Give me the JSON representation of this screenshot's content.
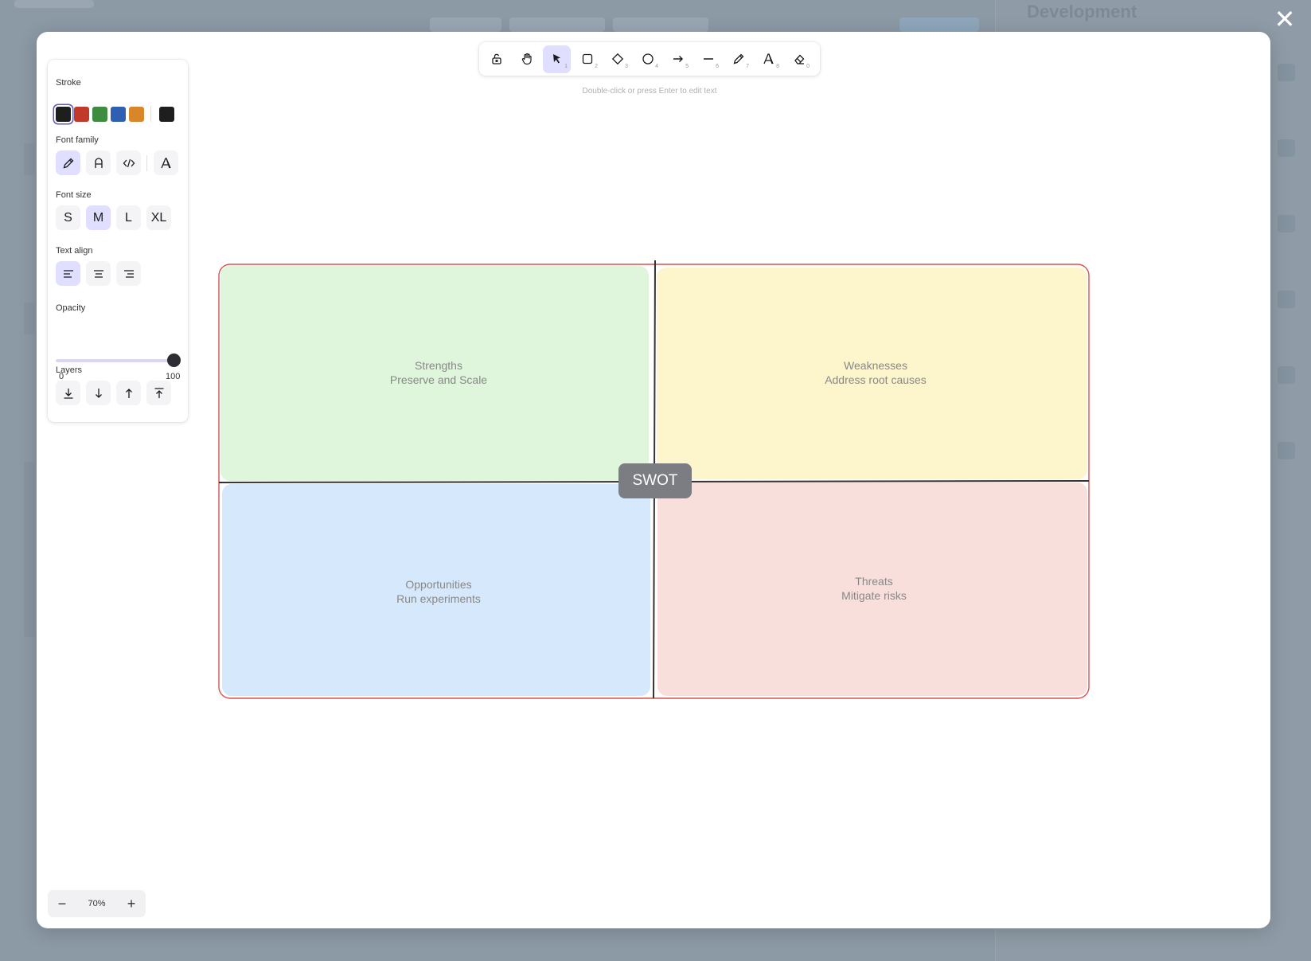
{
  "background": {
    "title": "Development"
  },
  "toolbar": {
    "tools": [
      {
        "name": "lock",
        "key": ""
      },
      {
        "name": "hand",
        "key": ""
      },
      {
        "name": "selection",
        "key": "1"
      },
      {
        "name": "rectangle",
        "key": "2"
      },
      {
        "name": "diamond",
        "key": "3"
      },
      {
        "name": "ellipse",
        "key": "4"
      },
      {
        "name": "arrow",
        "key": "5"
      },
      {
        "name": "line",
        "key": "6"
      },
      {
        "name": "draw",
        "key": "7"
      },
      {
        "name": "text",
        "key": "8"
      },
      {
        "name": "eraser",
        "key": "0"
      }
    ],
    "hint": "Double-click or press Enter to edit text"
  },
  "properties": {
    "stroke_label": "Stroke",
    "stroke_colors": [
      "#1e1e1e",
      "#c0392b",
      "#3d8c40",
      "#2f5fb3",
      "#d9862a"
    ],
    "current_stroke": "#1e1e1e",
    "font_family_label": "Font family",
    "font_size_label": "Font size",
    "font_sizes": [
      "S",
      "M",
      "L",
      "XL"
    ],
    "text_align_label": "Text align",
    "opacity_label": "Opacity",
    "opacity_min": "0",
    "opacity_max": "100",
    "opacity_value": 100,
    "layers_label": "Layers"
  },
  "canvas": {
    "center_label": "SWOT",
    "quadrants": {
      "strengths": {
        "title": "Strengths",
        "subtitle": "Preserve and Scale",
        "fill": "#dff5dc"
      },
      "weaknesses": {
        "title": "Weaknesses",
        "subtitle": "Address root causes",
        "fill": "#fdf5cc"
      },
      "opportunities": {
        "title": "Opportunities",
        "subtitle": "Run experiments",
        "fill": "#d6e8fb"
      },
      "threats": {
        "title": "Threats",
        "subtitle": "Mitigate risks",
        "fill": "#f9dfdc"
      }
    },
    "frame_stroke": "#d9534f"
  },
  "zoom": {
    "minus": "−",
    "value": "70%",
    "plus": "+"
  },
  "close_symbol": "✕"
}
